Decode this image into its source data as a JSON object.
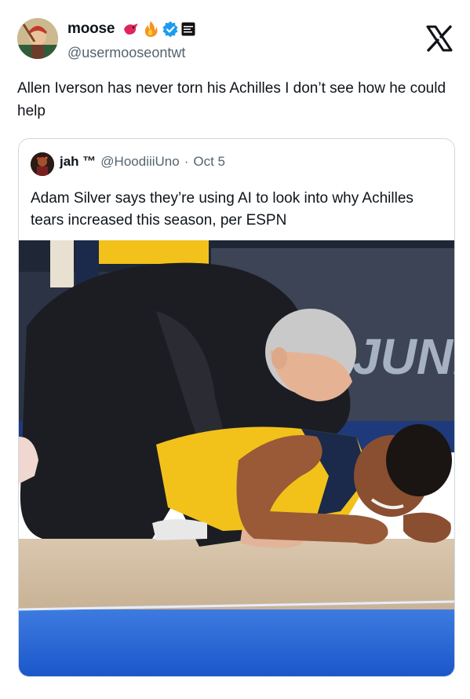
{
  "author": {
    "display_name": "moose",
    "handle": "@usermooseontwt",
    "badges": [
      "bird-emoji",
      "fire-emoji",
      "verified-badge-icon",
      "label-badge-icon"
    ]
  },
  "tweet": {
    "text": "Allen Iverson has never torn his Achilles I don’t see how he could help"
  },
  "quoted_tweet": {
    "display_name": "jah ™",
    "handle": "@HoodiiiUno",
    "separator": "·",
    "date": "Oct 5",
    "text": "Adam Silver says they’re using AI to look into why Achilles tears increased this season, per ESPN",
    "image": {
      "banner_text": "JUNE"
    }
  },
  "icons": {
    "x_logo": "x-logo-icon"
  },
  "colors": {
    "text": "#0f1419",
    "muted": "#536471",
    "verified": "#1d9bf0",
    "border": "#cfd9de",
    "court_blue": "#1f5fd6",
    "jersey_yellow": "#f2c21b",
    "jersey_navy": "#1b2a4a"
  }
}
